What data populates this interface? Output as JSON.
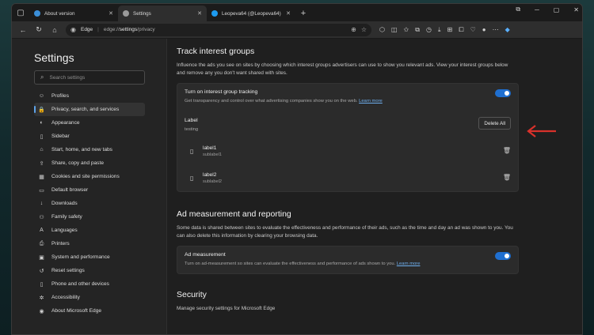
{
  "tabs": [
    {
      "title": "About version",
      "favicon_color": "#3b8fd9",
      "active": false
    },
    {
      "title": "Settings",
      "favicon_color": "#9a9a9a",
      "active": true
    },
    {
      "title": "Leopeva64 (@Leopeva64) / Twitt",
      "favicon_color": "#1d9bf0",
      "active": false
    }
  ],
  "address": {
    "site": "Edge",
    "url_prefix": "edge://",
    "url_bold": "settings",
    "url_suffix": "/privacy"
  },
  "sidebar": {
    "title": "Settings",
    "search_placeholder": "Search settings",
    "items": [
      {
        "label": "Profiles",
        "icon": "profile-icon",
        "glyph": "☺",
        "active": false
      },
      {
        "label": "Privacy, search, and services",
        "icon": "lock-icon",
        "glyph": "🔒",
        "active": true
      },
      {
        "label": "Appearance",
        "icon": "appearance-icon",
        "glyph": "◐",
        "active": false
      },
      {
        "label": "Sidebar",
        "icon": "sidebar-icon",
        "glyph": "▯",
        "active": false
      },
      {
        "label": "Start, home, and new tabs",
        "icon": "home-icon",
        "glyph": "⌂",
        "active": false
      },
      {
        "label": "Share, copy and paste",
        "icon": "share-icon",
        "glyph": "⇪",
        "active": false
      },
      {
        "label": "Cookies and site permissions",
        "icon": "cookie-icon",
        "glyph": "▦",
        "active": false
      },
      {
        "label": "Default browser",
        "icon": "browser-icon",
        "glyph": "▭",
        "active": false
      },
      {
        "label": "Downloads",
        "icon": "download-icon",
        "glyph": "↓",
        "active": false
      },
      {
        "label": "Family safety",
        "icon": "family-icon",
        "glyph": "⚇",
        "active": false
      },
      {
        "label": "Languages",
        "icon": "language-icon",
        "glyph": "A",
        "active": false
      },
      {
        "label": "Printers",
        "icon": "printer-icon",
        "glyph": "⎙",
        "active": false
      },
      {
        "label": "System and performance",
        "icon": "system-icon",
        "glyph": "▣",
        "active": false
      },
      {
        "label": "Reset settings",
        "icon": "reset-icon",
        "glyph": "↺",
        "active": false
      },
      {
        "label": "Phone and other devices",
        "icon": "phone-icon",
        "glyph": "▯",
        "active": false
      },
      {
        "label": "Accessibility",
        "icon": "accessibility-icon",
        "glyph": "✲",
        "active": false
      },
      {
        "label": "About Microsoft Edge",
        "icon": "edge-icon",
        "glyph": "◉",
        "active": false
      }
    ]
  },
  "main": {
    "interest": {
      "heading": "Track interest groups",
      "description": "Influence the ads you see on sites by choosing which interest groups advertisers can use to show you relevant ads. View your interest groups below and remove any you don't want shared with sites.",
      "toggle_title": "Turn on interest group tracking",
      "toggle_sub": "Get transparency and control over what advertising companies show you on the web.",
      "learn_more": "Learn more",
      "label_title": "Label",
      "label_sub": "testing",
      "delete_all": "Delete All",
      "labels": [
        {
          "title": "label1",
          "sub": "sublabel1"
        },
        {
          "title": "label2",
          "sub": "sublabel2"
        }
      ]
    },
    "ad_measurement": {
      "heading": "Ad measurement and reporting",
      "description": "Some data is shared between sites to evaluate the effectiveness and performance of their ads, such as the time and day an ad was shown to you. You can also delete this information by clearing your browsing data.",
      "toggle_title": "Ad measurement",
      "toggle_sub": "Turn on ad-measurement so sites can evaluate the effectiveness and performance of ads shown to you.",
      "learn_more": "Learn more"
    },
    "security": {
      "heading": "Security",
      "description": "Manage security settings for Microsoft Edge"
    }
  },
  "accent_color": "#1f6fd0",
  "annotation_arrow_color": "#d9312b"
}
